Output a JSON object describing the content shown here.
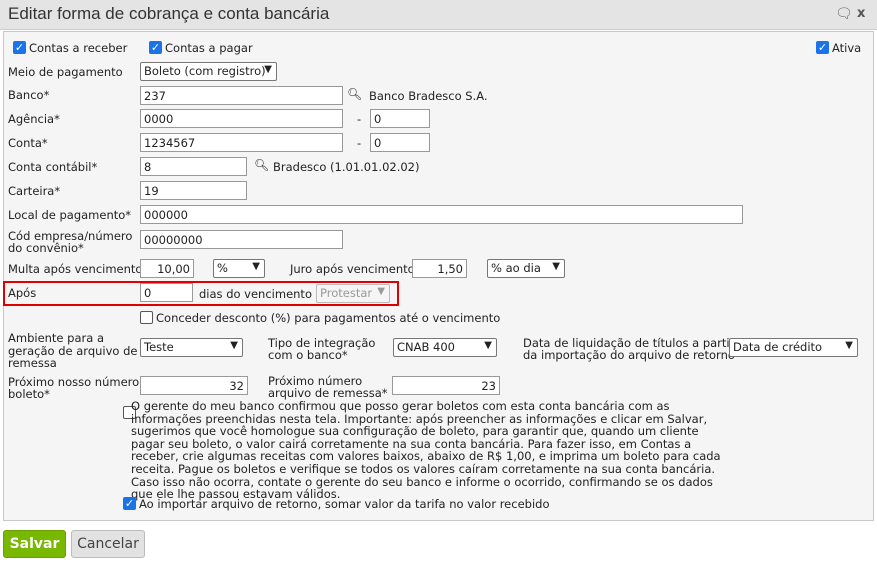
{
  "window": {
    "title": "Editar forma de cobrança e conta bancária"
  },
  "flags": {
    "contas_receber": "Contas a receber",
    "contas_pagar": "Contas a pagar",
    "ativa": "Ativa"
  },
  "form": {
    "meio_label": "Meio de pagamento",
    "meio_value": "Boleto (com registro)",
    "banco_label": "Banco*",
    "banco_value": "237",
    "banco_name": "Banco Bradesco S.A.",
    "agencia_label": "Agência*",
    "agencia_value": "0000",
    "agencia_dv": "0",
    "conta_label": "Conta*",
    "conta_value": "1234567",
    "conta_dv": "0",
    "dash": "-",
    "contabil_label": "Conta contábil*",
    "contabil_value": "8",
    "contabil_name": "Bradesco (1.01.01.02.02)",
    "carteira_label": "Carteira*",
    "carteira_value": "19",
    "local_label": "Local de pagamento*",
    "local_value": "000000",
    "cod_label_1": "Cód empresa/número",
    "cod_label_2": "do convênio*",
    "cod_value": "00000000",
    "multa_label": "Multa após vencimento",
    "multa_value": "10,00",
    "multa_unit": "%",
    "juro_label": "Juro após vencimento",
    "juro_value": "1,50",
    "juro_unit": "% ao dia",
    "apos_label": "Após",
    "apos_value": "0",
    "apos_suffix": "dias do vencimento",
    "apos_action": "Protestar",
    "desconto_label": "Conceder desconto (%) para pagamentos até o vencimento",
    "ambiente_label_1": "Ambiente para a",
    "ambiente_label_2": "geração de arquivo de",
    "ambiente_label_3": "remessa",
    "ambiente_value": "Teste",
    "tipo_label_1": "Tipo de integração",
    "tipo_label_2": "com o banco*",
    "tipo_value": "CNAB 400",
    "liq_label_1": "Data de liquidação de títulos a partir",
    "liq_label_2": "da importação do arquivo de retorno",
    "liq_value": "Data de crédito",
    "nosso_label_1": "Próximo nosso número",
    "nosso_label_2": "boleto*",
    "nosso_value": "32",
    "remessa_label_1": "Próximo número",
    "remessa_label_2": "arquivo de remessa*",
    "remessa_value": "23",
    "gerente_text": "O gerente do meu banco confirmou que posso gerar boletos com esta conta bancária com as informações preenchidas nesta tela. Importante: após preencher as informações e clicar em Salvar, sugerimos que você homologue sua configuração de boleto, para garantir que, quando um cliente pagar seu boleto, o valor cairá corretamente na sua conta bancária. Para fazer isso, em Contas a receber, crie algumas receitas com valores baixos, abaixo de R$ 1,00, e imprima um boleto para cada receita. Pague os boletos e verifique se todos os valores caíram corretamente na sua conta bancária. Caso isso não ocorra, contate o gerente do seu banco e informe o ocorrido, confirmando se os dados que ele lhe passou estavam válidos.",
    "tarifa_label": "Ao importar arquivo de retorno, somar valor da tarifa no valor recebido"
  },
  "buttons": {
    "save": "Salvar",
    "cancel": "Cancelar"
  },
  "colors": {
    "accent": "#78b800",
    "highlight": "#e00000",
    "checkbox": "#1a73e8"
  }
}
